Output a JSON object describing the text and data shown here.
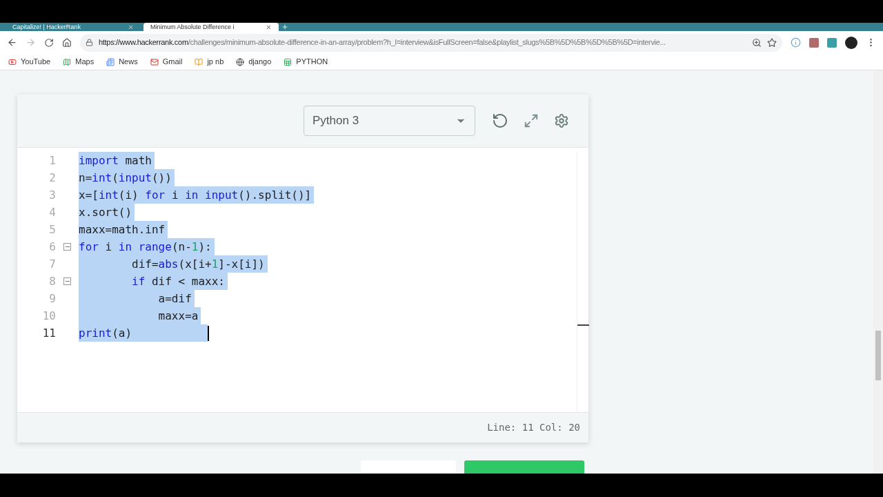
{
  "browser": {
    "tabs": [
      {
        "title": "Capitalize! | HackerRank",
        "selected": false
      },
      {
        "title": "Minimum Absolute Difference i",
        "selected": true
      }
    ],
    "url_host": "https://www.hackerrank.com",
    "url_path": "/challenges/minimum-absolute-difference-in-an-array/problem?h_l=interview&isFullScreen=false&playlist_slugs%5B%5D%5B%5D%5B%5D=intervie...",
    "bookmarks": [
      {
        "label": "YouTube",
        "kind": "youtube"
      },
      {
        "label": "Maps",
        "kind": "maps"
      },
      {
        "label": "News",
        "kind": "news"
      },
      {
        "label": "Gmail",
        "kind": "gmail"
      },
      {
        "label": "jp nb",
        "kind": "book"
      },
      {
        "label": "django",
        "kind": "globe"
      },
      {
        "label": "PYTHON",
        "kind": "sheet"
      }
    ]
  },
  "editor": {
    "language": "Python 3",
    "lines": [
      {
        "number": "1",
        "foldable": false,
        "selected": true,
        "tokens": [
          {
            "kind": "kw",
            "text": "import"
          },
          {
            "kind": "plain",
            "text": " math"
          }
        ]
      },
      {
        "number": "2",
        "foldable": false,
        "selected": true,
        "tokens": [
          {
            "kind": "plain",
            "text": "n="
          },
          {
            "kind": "kw",
            "text": "int"
          },
          {
            "kind": "plain",
            "text": "("
          },
          {
            "kind": "kw",
            "text": "input"
          },
          {
            "kind": "plain",
            "text": "())"
          }
        ]
      },
      {
        "number": "3",
        "foldable": false,
        "selected": true,
        "tokens": [
          {
            "kind": "plain",
            "text": "x=["
          },
          {
            "kind": "kw",
            "text": "int"
          },
          {
            "kind": "plain",
            "text": "(i) "
          },
          {
            "kind": "kw",
            "text": "for"
          },
          {
            "kind": "plain",
            "text": " i "
          },
          {
            "kind": "kw",
            "text": "in input"
          },
          {
            "kind": "plain",
            "text": "().split()]"
          }
        ]
      },
      {
        "number": "4",
        "foldable": false,
        "selected": true,
        "tokens": [
          {
            "kind": "plain",
            "text": "x.sort()"
          }
        ]
      },
      {
        "number": "5",
        "foldable": false,
        "selected": true,
        "tokens": [
          {
            "kind": "plain",
            "text": "maxx=math.inf"
          }
        ]
      },
      {
        "number": "6",
        "foldable": true,
        "selected": true,
        "tokens": [
          {
            "kind": "kw",
            "text": "for"
          },
          {
            "kind": "plain",
            "text": " i "
          },
          {
            "kind": "kw",
            "text": "in range"
          },
          {
            "kind": "plain",
            "text": "(n-"
          },
          {
            "kind": "num",
            "text": "1"
          },
          {
            "kind": "plain",
            "text": "):"
          }
        ]
      },
      {
        "number": "7",
        "foldable": false,
        "selected": true,
        "tokens": [
          {
            "kind": "plain",
            "text": "        dif="
          },
          {
            "kind": "kw",
            "text": "abs"
          },
          {
            "kind": "plain",
            "text": "(x[i+"
          },
          {
            "kind": "num",
            "text": "1"
          },
          {
            "kind": "plain",
            "text": "]-x[i])"
          }
        ]
      },
      {
        "number": "8",
        "foldable": true,
        "selected": true,
        "tokens": [
          {
            "kind": "kw",
            "text": "        if"
          },
          {
            "kind": "plain",
            "text": " dif < maxx:"
          }
        ]
      },
      {
        "number": "9",
        "foldable": false,
        "selected": true,
        "tokens": [
          {
            "kind": "plain",
            "text": "            a=dif"
          }
        ]
      },
      {
        "number": "10",
        "foldable": false,
        "selected": true,
        "tokens": [
          {
            "kind": "plain",
            "text": "            maxx=a"
          }
        ]
      },
      {
        "number": "11",
        "foldable": false,
        "selected": true,
        "tokens": [
          {
            "kind": "kw",
            "text": "print"
          },
          {
            "kind": "plain",
            "text": "(a)           "
          }
        ]
      }
    ],
    "status": "Line: 11 Col: 20"
  }
}
